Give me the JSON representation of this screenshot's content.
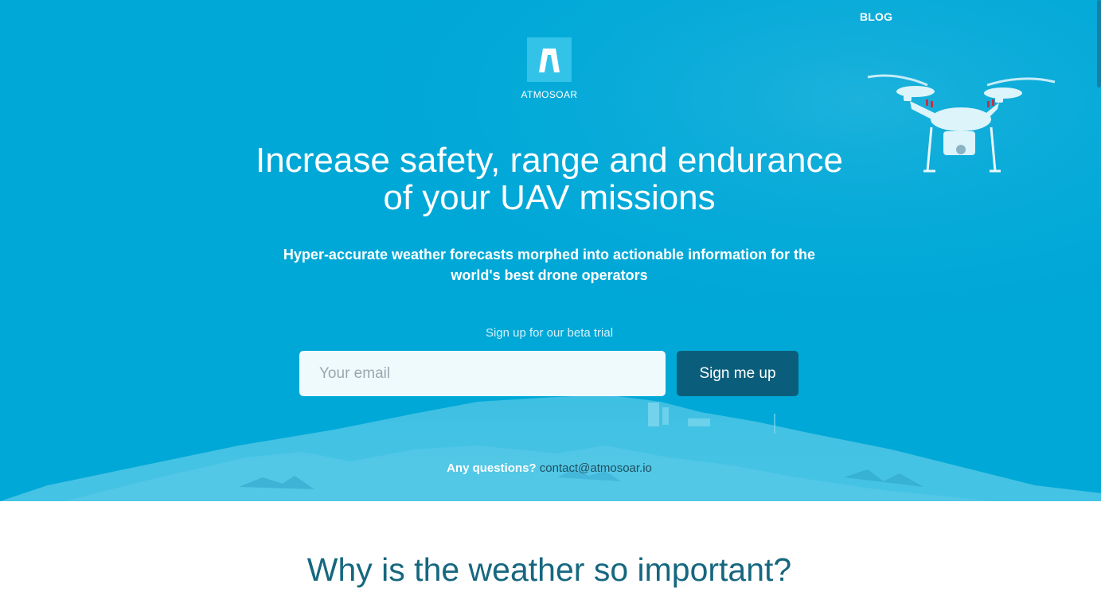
{
  "nav": {
    "blog_label": "BLOG"
  },
  "brand": {
    "name": "ATMOSOAR",
    "logo_icon": "atmosoar-logo-icon"
  },
  "hero": {
    "headline_line1": "Increase safety, range and endurance",
    "headline_line2": "of your UAV missions",
    "subheadline_line1": "Hyper-accurate weather forecasts morphed into actionable information for the",
    "subheadline_line2": "world's best drone operators",
    "signup_caption": "Sign up for our beta trial",
    "email_placeholder": "Your email",
    "signup_button_label": "Sign me up",
    "questions_label": "Any questions?",
    "contact_email": "contact@atmosoar.io",
    "drone_image": "drone-quadcopter-image"
  },
  "section": {
    "title": "Why is the weather so important?"
  },
  "colors": {
    "hero_background": "#00a8d7",
    "button_background": "#0b5e7b",
    "section_title": "#16677f"
  }
}
